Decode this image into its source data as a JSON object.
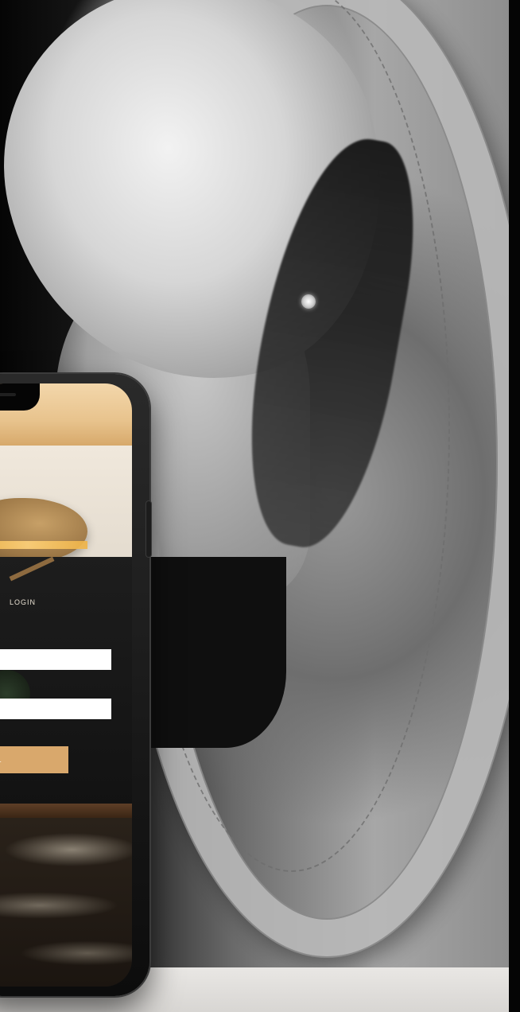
{
  "phone_screen": {
    "login_title": "LOGIN",
    "cancel_label": "CEL"
  }
}
